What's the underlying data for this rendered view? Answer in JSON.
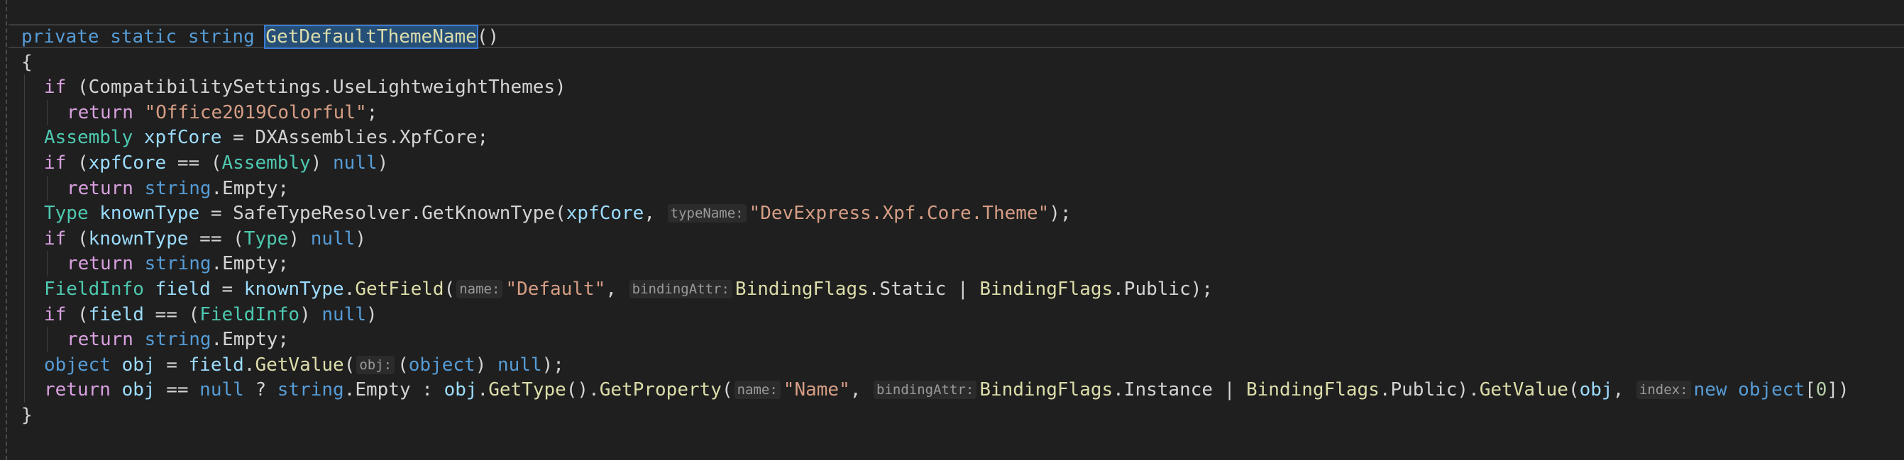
{
  "editor": {
    "language": "csharp",
    "highlighted_symbol": "GetDefaultThemeName",
    "lines": [
      {
        "indent": 0,
        "tokens": [
          {
            "c": "kw",
            "t": "private"
          },
          {
            "c": "pl",
            "t": " "
          },
          {
            "c": "kw",
            "t": "static"
          },
          {
            "c": "pl",
            "t": " "
          },
          {
            "c": "kw",
            "t": "string"
          },
          {
            "c": "pl",
            "t": " "
          },
          {
            "c": "hl",
            "t": "GetDefaultThemeName"
          },
          {
            "c": "pl",
            "t": "()"
          }
        ]
      },
      {
        "indent": 0,
        "tokens": [
          {
            "c": "pl",
            "t": "{"
          }
        ]
      },
      {
        "indent": 1,
        "tokens": [
          {
            "c": "ctl",
            "t": "if"
          },
          {
            "c": "pl",
            "t": " (CompatibilitySettings.UseLightweightThemes)"
          }
        ]
      },
      {
        "indent": 2,
        "tokens": [
          {
            "c": "ctl",
            "t": "return"
          },
          {
            "c": "pl",
            "t": " "
          },
          {
            "c": "str",
            "t": "\"Office2019Colorful\""
          },
          {
            "c": "pl",
            "t": ";"
          }
        ]
      },
      {
        "indent": 1,
        "tokens": [
          {
            "c": "type",
            "t": "Assembly"
          },
          {
            "c": "pl",
            "t": " "
          },
          {
            "c": "ident",
            "t": "xpfCore"
          },
          {
            "c": "pl",
            "t": " = DXAssemblies.XpfCore;"
          }
        ]
      },
      {
        "indent": 1,
        "tokens": [
          {
            "c": "ctl",
            "t": "if"
          },
          {
            "c": "pl",
            "t": " ("
          },
          {
            "c": "ident",
            "t": "xpfCore"
          },
          {
            "c": "pl",
            "t": " == ("
          },
          {
            "c": "type",
            "t": "Assembly"
          },
          {
            "c": "pl",
            "t": ") "
          },
          {
            "c": "kw",
            "t": "null"
          },
          {
            "c": "pl",
            "t": ")"
          }
        ]
      },
      {
        "indent": 2,
        "tokens": [
          {
            "c": "ctl",
            "t": "return"
          },
          {
            "c": "pl",
            "t": " "
          },
          {
            "c": "kw",
            "t": "string"
          },
          {
            "c": "pl",
            "t": ".Empty;"
          }
        ]
      },
      {
        "indent": 1,
        "tokens": [
          {
            "c": "type",
            "t": "Type"
          },
          {
            "c": "pl",
            "t": " "
          },
          {
            "c": "ident",
            "t": "knownType"
          },
          {
            "c": "pl",
            "t": " = SafeTypeResolver.GetKnownType("
          },
          {
            "c": "ident",
            "t": "xpfCore"
          },
          {
            "c": "pl",
            "t": ", "
          },
          {
            "c": "hint",
            "t": "typeName:"
          },
          {
            "c": "str",
            "t": "\"DevExpress.Xpf.Core.Theme\""
          },
          {
            "c": "pl",
            "t": ");"
          }
        ]
      },
      {
        "indent": 1,
        "tokens": [
          {
            "c": "ctl",
            "t": "if"
          },
          {
            "c": "pl",
            "t": " ("
          },
          {
            "c": "ident",
            "t": "knownType"
          },
          {
            "c": "pl",
            "t": " == ("
          },
          {
            "c": "type",
            "t": "Type"
          },
          {
            "c": "pl",
            "t": ") "
          },
          {
            "c": "kw",
            "t": "null"
          },
          {
            "c": "pl",
            "t": ")"
          }
        ]
      },
      {
        "indent": 2,
        "tokens": [
          {
            "c": "ctl",
            "t": "return"
          },
          {
            "c": "pl",
            "t": " "
          },
          {
            "c": "kw",
            "t": "string"
          },
          {
            "c": "pl",
            "t": ".Empty;"
          }
        ]
      },
      {
        "indent": 1,
        "tokens": [
          {
            "c": "type",
            "t": "FieldInfo"
          },
          {
            "c": "pl",
            "t": " "
          },
          {
            "c": "ident",
            "t": "field"
          },
          {
            "c": "pl",
            "t": " = "
          },
          {
            "c": "ident",
            "t": "knownType"
          },
          {
            "c": "pl",
            "t": "."
          },
          {
            "c": "method",
            "t": "GetField"
          },
          {
            "c": "pl",
            "t": "("
          },
          {
            "c": "hint",
            "t": "name:"
          },
          {
            "c": "str",
            "t": "\"Default\""
          },
          {
            "c": "pl",
            "t": ", "
          },
          {
            "c": "hint",
            "t": "bindingAttr:"
          },
          {
            "c": "method",
            "t": "BindingFlags"
          },
          {
            "c": "pl",
            "t": ".Static | "
          },
          {
            "c": "method",
            "t": "BindingFlags"
          },
          {
            "c": "pl",
            "t": ".Public);"
          }
        ]
      },
      {
        "indent": 1,
        "tokens": [
          {
            "c": "ctl",
            "t": "if"
          },
          {
            "c": "pl",
            "t": " ("
          },
          {
            "c": "ident",
            "t": "field"
          },
          {
            "c": "pl",
            "t": " == ("
          },
          {
            "c": "type",
            "t": "FieldInfo"
          },
          {
            "c": "pl",
            "t": ") "
          },
          {
            "c": "kw",
            "t": "null"
          },
          {
            "c": "pl",
            "t": ")"
          }
        ]
      },
      {
        "indent": 2,
        "tokens": [
          {
            "c": "ctl",
            "t": "return"
          },
          {
            "c": "pl",
            "t": " "
          },
          {
            "c": "kw",
            "t": "string"
          },
          {
            "c": "pl",
            "t": ".Empty;"
          }
        ]
      },
      {
        "indent": 1,
        "tokens": [
          {
            "c": "kw",
            "t": "object"
          },
          {
            "c": "pl",
            "t": " "
          },
          {
            "c": "ident",
            "t": "obj"
          },
          {
            "c": "pl",
            "t": " = "
          },
          {
            "c": "ident",
            "t": "field"
          },
          {
            "c": "pl",
            "t": "."
          },
          {
            "c": "method",
            "t": "GetValue"
          },
          {
            "c": "pl",
            "t": "("
          },
          {
            "c": "hint",
            "t": "obj:"
          },
          {
            "c": "pl",
            "t": "("
          },
          {
            "c": "kw",
            "t": "object"
          },
          {
            "c": "pl",
            "t": ") "
          },
          {
            "c": "kw",
            "t": "null"
          },
          {
            "c": "pl",
            "t": ");"
          }
        ]
      },
      {
        "indent": 1,
        "tokens": [
          {
            "c": "ctl",
            "t": "return"
          },
          {
            "c": "pl",
            "t": " "
          },
          {
            "c": "ident",
            "t": "obj"
          },
          {
            "c": "pl",
            "t": " == "
          },
          {
            "c": "kw",
            "t": "null"
          },
          {
            "c": "pl",
            "t": " ? "
          },
          {
            "c": "kw",
            "t": "string"
          },
          {
            "c": "pl",
            "t": ".Empty : "
          },
          {
            "c": "ident",
            "t": "obj"
          },
          {
            "c": "pl",
            "t": "."
          },
          {
            "c": "method",
            "t": "GetType"
          },
          {
            "c": "pl",
            "t": "()."
          },
          {
            "c": "method",
            "t": "GetProperty"
          },
          {
            "c": "pl",
            "t": "("
          },
          {
            "c": "hint",
            "t": "name:"
          },
          {
            "c": "str",
            "t": "\"Name\""
          },
          {
            "c": "pl",
            "t": ", "
          },
          {
            "c": "hint",
            "t": "bindingAttr:"
          },
          {
            "c": "method",
            "t": "BindingFlags"
          },
          {
            "c": "pl",
            "t": ".Instance | "
          },
          {
            "c": "method",
            "t": "BindingFlags"
          },
          {
            "c": "pl",
            "t": ".Public)."
          },
          {
            "c": "method",
            "t": "GetValue"
          },
          {
            "c": "pl",
            "t": "("
          },
          {
            "c": "ident",
            "t": "obj"
          },
          {
            "c": "pl",
            "t": ", "
          },
          {
            "c": "hint",
            "t": "index:"
          },
          {
            "c": "kw",
            "t": "new"
          },
          {
            "c": "pl",
            "t": " "
          },
          {
            "c": "kw",
            "t": "object"
          },
          {
            "c": "pl",
            "t": "["
          },
          {
            "c": "num",
            "t": "0"
          },
          {
            "c": "pl",
            "t": "])"
          }
        ]
      },
      {
        "indent": 0,
        "tokens": [
          {
            "c": "pl",
            "t": "}"
          }
        ]
      }
    ]
  }
}
